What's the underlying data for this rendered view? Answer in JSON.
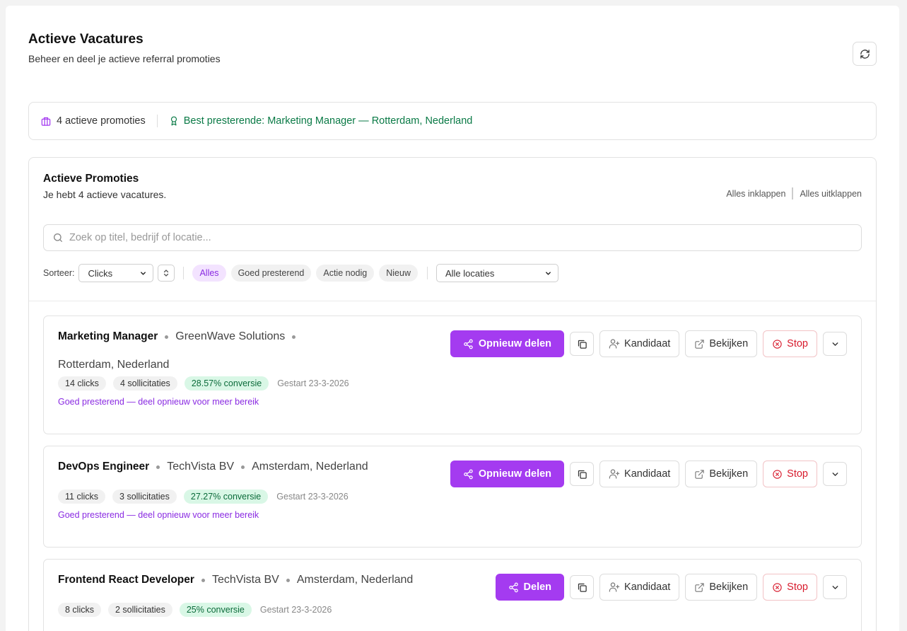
{
  "header": {
    "title": "Actieve Vacatures",
    "subtitle": "Beheer en deel je actieve referral promoties"
  },
  "summary": {
    "active_count": "4 actieve promoties",
    "best_performing": "Best presterende: Marketing Manager — Rotterdam, Nederland"
  },
  "panel": {
    "title": "Actieve Promoties",
    "subtitle": "Je hebt 4 actieve vacatures.",
    "collapse_all": "Alles inklappen",
    "expand_all": "Alles uitklappen",
    "search_placeholder": "Zoek op titel, bedrijf of locatie...",
    "sort_label": "Sorteer:",
    "sort_value": "Clicks",
    "filter_chips": [
      "Alles",
      "Goed presterend",
      "Actie nodig",
      "Nieuw"
    ],
    "active_chip": "Alles",
    "location_value": "Alle locaties"
  },
  "actions": {
    "copy": "copy-icon",
    "candidate": "Kandidaat",
    "view": "Bekijken",
    "stop": "Stop"
  },
  "cards": [
    {
      "title": "Marketing Manager",
      "company": "GreenWave Solutions",
      "location": "Rotterdam, Nederland",
      "clicks": "14 clicks",
      "applications": "4 sollicitaties",
      "conversion": "28.57% conversie",
      "started": "Gestart 23-3-2026",
      "hint": "Goed presterend — deel opnieuw voor meer bereik",
      "share_label": "Opnieuw delen"
    },
    {
      "title": "DevOps Engineer",
      "company": "TechVista BV",
      "location": "Amsterdam, Nederland",
      "clicks": "11 clicks",
      "applications": "3 sollicitaties",
      "conversion": "27.27% conversie",
      "started": "Gestart 23-3-2026",
      "hint": "Goed presterend — deel opnieuw voor meer bereik",
      "share_label": "Opnieuw delen"
    },
    {
      "title": "Frontend React Developer",
      "company": "TechVista BV",
      "location": "Amsterdam, Nederland",
      "clicks": "8 clicks",
      "applications": "2 sollicitaties",
      "conversion": "25% conversie",
      "started": "Gestart 23-3-2026",
      "share_label": "Delen"
    }
  ],
  "colors": {
    "accent": "#a43bf0",
    "success_text": "#0a7a46",
    "danger": "#d81b2d"
  }
}
